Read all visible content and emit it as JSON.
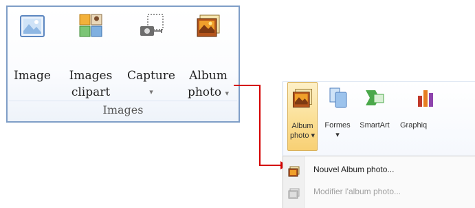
{
  "left_group": {
    "buttons": [
      {
        "label": "Image",
        "icon": "image-icon"
      },
      {
        "label": "Images clipart",
        "icon": "clipart-icon"
      },
      {
        "label": "Capture",
        "icon": "screenshot-icon",
        "caret": "▾"
      },
      {
        "label": "Album photo",
        "icon": "photo-album-icon",
        "caret": "▾"
      }
    ],
    "group_label": "Images"
  },
  "right_ribbon": {
    "buttons": [
      {
        "label": "Album photo",
        "caret": "▾",
        "active": true,
        "icon": "photo-album-icon"
      },
      {
        "label": "Formes",
        "caret": "▾",
        "icon": "shapes-icon"
      },
      {
        "label": "SmartArt",
        "icon": "smartart-icon"
      },
      {
        "label": "Graphiq",
        "icon": "chart-icon"
      }
    ]
  },
  "dropdown_menu": {
    "items": [
      {
        "label": "Nouvel Album photo...",
        "enabled": true,
        "icon": "new-album-icon"
      },
      {
        "label": "Modifier l'album photo...",
        "enabled": false,
        "icon": "edit-album-icon"
      }
    ]
  },
  "colors": {
    "arrow": "#d40000",
    "group_border": "#7f9ec7",
    "active_button": "#f8d074"
  }
}
